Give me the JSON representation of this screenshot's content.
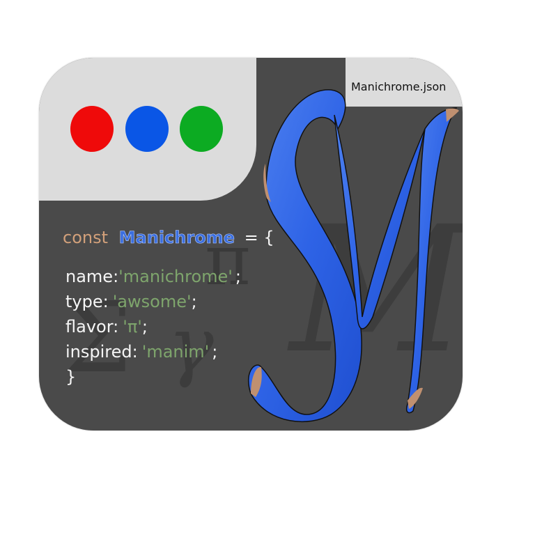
{
  "window": {
    "tab_label": "Manichrome.json",
    "colors": {
      "body": "#4a4a4a",
      "panel": "#dcdcdc",
      "dot_red": "#ef0a0a",
      "dot_blue": "#0a56e6",
      "dot_green": "#0cab22"
    }
  },
  "code": {
    "keyword": "const",
    "identifier": "Manichrome",
    "assign": "= {",
    "lines": [
      {
        "key": "name:",
        "value": "'manichrome'",
        "end": ";"
      },
      {
        "key": "type:",
        "value": "'awsome'",
        "end": ";"
      },
      {
        "key": "flavor:",
        "value": "'π'",
        "end": ";"
      },
      {
        "key": "inspired:",
        "value": "'manim'",
        "end": ";"
      }
    ],
    "close": "}",
    "colors": {
      "keyword": "#d2a07a",
      "identifier": "#3b6fe0",
      "string": "#7ea56c",
      "text": "#f5f5f5"
    }
  },
  "logo": {
    "letter": "M",
    "color": "#2e63e6",
    "tip_color": "#c09070"
  },
  "background_symbols": [
    "Σ",
    "π",
    "γ",
    "M"
  ]
}
